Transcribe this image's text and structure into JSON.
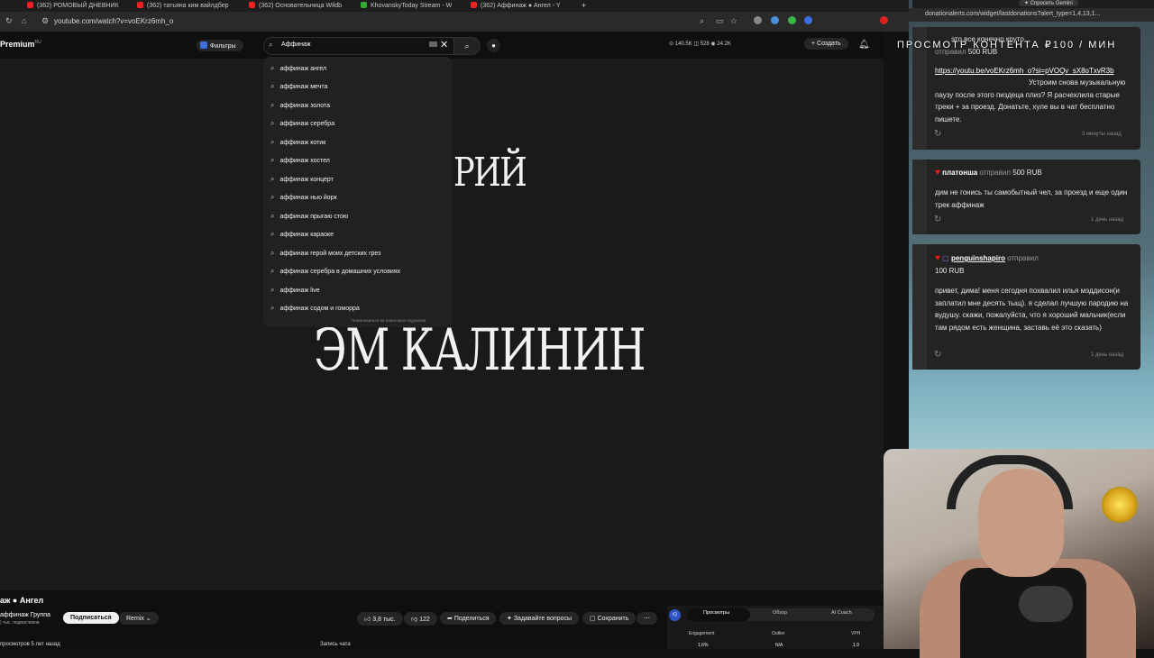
{
  "browser": {
    "tabs": [
      {
        "label": "(362) РОМОВЫЙ ДНЕВНИК"
      },
      {
        "label": "(362) татьяна ким вайлдбер"
      },
      {
        "label": "(362) Основательница Wildb"
      },
      {
        "label": "KhovanskyToday Stream - W"
      },
      {
        "label": "(362) Аффинаж ● Ангел - Y"
      }
    ],
    "url": "youtube.com/watch?v=voEKrz6mh_o"
  },
  "youtube": {
    "logo": "Premium",
    "logo_region": "RU",
    "filters_label": "Фильтры",
    "search_value": "Аффинаж",
    "stats": "⊙ 140.5K   ◫ 528   ◉ 24.2K",
    "create_label": "+ Создать",
    "suggestions": [
      "аффинаж ангел",
      "аффинаж мечта",
      "аффинаж золота",
      "аффинаж серебра",
      "аффинаж котик",
      "аффинаж хостел",
      "аффинаж концерт",
      "аффинаж нью йорк",
      "аффинаж прыгаю стою",
      "аффинаж караоке",
      "аффинаж герой моих детских грез",
      "аффинаж серебра в домашних условиях",
      "аффинаж live",
      "аффинаж содом и гоморра"
    ],
    "report_label": "Пожаловаться на поисковые подсказки",
    "video_text_top": "РИЙ",
    "video_text_bottom": "ЭМ КАЛИНИН",
    "video_title": "аж ● Ангел",
    "channel": "аффинаж Группа",
    "subscribers": ") тыс. подписчиков",
    "subscribe_label": "Подписаться",
    "remix_label": "Remix",
    "likes": "3,8 тыс.",
    "dislikes": "122",
    "share_label": "Поделиться",
    "ask_label": "Задавайте вопросы",
    "save_label": "Сохранить",
    "views_line": "просмотров  5 лет назад",
    "chat_record": "Запись чата",
    "side_tabs": [
      "Просмотры",
      "Обзор",
      "AI Coach"
    ],
    "side_metrics": [
      {
        "label": "Engagement",
        "value": "1.6%"
      },
      {
        "label": "Outlier",
        "value": "N/A"
      },
      {
        "label": "VPH",
        "value": "1.9"
      }
    ]
  },
  "stream": {
    "url": "donationalerts.com/widget/lastdonations?alert_type=1,4,13,1...",
    "overlay_title": "ПРОСМОТР КОНТЕНТА ₽100 / МИН",
    "donations": [
      {
        "header": "это все конечно круто",
        "sender_word": "отправил",
        "amount": "500 RUB",
        "link": "https://youtu.be/voEKrz6mh_o?si=pVOQv_sX8oTxvR3b",
        "message": "Устроим снова музыкальную паузу после этого пиздеца плиз? Я расчехлила старые треки + за проезд. Донатьте, хуле вы в чат бесплатно пишете.",
        "time": "3 минуты назад"
      },
      {
        "name": "платонша",
        "sender_word": "отправил",
        "amount": "500 RUB",
        "message": "дим не гонись ты самобытный чел, за проезд и еще один трек аффинаж",
        "time": "1 день назад"
      },
      {
        "name": "penguinshapiro",
        "sender_word": "отправил",
        "amount": "100 RUB",
        "message": "привет, дима! меня сегодня похвалил илья мэддисон(и заплатил мне десять тыщ). я сделал лучшую пародию на вудушу. скажи, пожалуйста, что я хороший мальчик(если там рядом есть женщина, заставь её это сказать)",
        "time": "1 день назад"
      }
    ]
  }
}
